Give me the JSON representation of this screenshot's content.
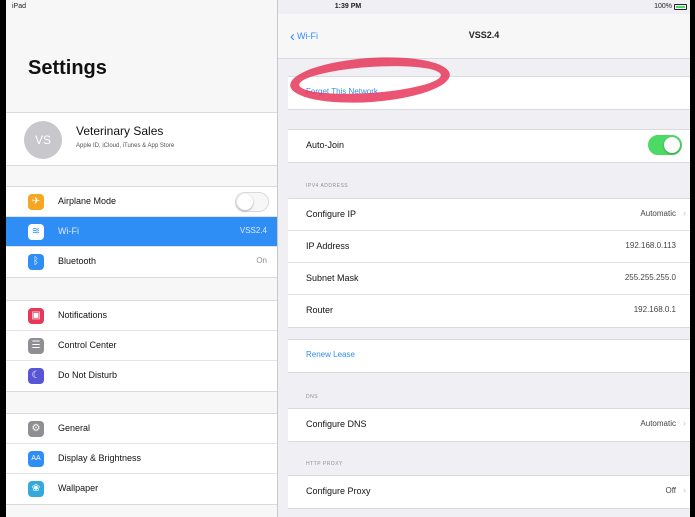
{
  "status": {
    "left": "iPad",
    "time": "1:39 PM",
    "right": "100%"
  },
  "sidebar": {
    "title": "Settings",
    "profile": {
      "initials": "VS",
      "name": "Veterinary Sales",
      "subtitle": "Apple ID, iCloud, iTunes & App Store"
    },
    "group1": [
      {
        "label": "Airplane Mode",
        "icon": "airplane-icon",
        "color": "#f5a623",
        "glyph": "✈",
        "toggle": false
      },
      {
        "label": "Wi-Fi",
        "icon": "wifi-icon",
        "color": "#2f8ef6",
        "glyph": "≋",
        "value": "VSS2.4",
        "selected": true
      },
      {
        "label": "Bluetooth",
        "icon": "bluetooth-icon",
        "color": "#2f8ef6",
        "glyph": "ᛒ",
        "value": "On"
      }
    ],
    "group2": [
      {
        "label": "Notifications",
        "icon": "notifications-icon",
        "color": "#e7375a",
        "glyph": "▣"
      },
      {
        "label": "Control Center",
        "icon": "control-center-icon",
        "color": "#8e8e93",
        "glyph": "☰"
      },
      {
        "label": "Do Not Disturb",
        "icon": "moon-icon",
        "color": "#5856d6",
        "glyph": "☾"
      }
    ],
    "group3": [
      {
        "label": "General",
        "icon": "gear-icon",
        "color": "#8e8e93",
        "glyph": "⚙"
      },
      {
        "label": "Display & Brightness",
        "icon": "brightness-icon",
        "color": "#2f8ef6",
        "glyph": "AA"
      },
      {
        "label": "Wallpaper",
        "icon": "wallpaper-icon",
        "color": "#34aadc",
        "glyph": "❀"
      }
    ]
  },
  "detail": {
    "back_label": "Wi-Fi",
    "title": "VSS2.4",
    "forget_label": "Forget This Network",
    "auto_join": {
      "label": "Auto-Join",
      "on": true
    },
    "ipv4_header": "IPV4 ADDRESS",
    "ipv4": [
      {
        "label": "Configure IP",
        "value": "Automatic",
        "chevron": true
      },
      {
        "label": "IP Address",
        "value": "192.168.0.113"
      },
      {
        "label": "Subnet Mask",
        "value": "255.255.255.0"
      },
      {
        "label": "Router",
        "value": "192.168.0.1"
      }
    ],
    "renew_label": "Renew Lease",
    "dns_header": "DNS",
    "dns": {
      "label": "Configure DNS",
      "value": "Automatic"
    },
    "proxy_header": "HTTP PROXY",
    "proxy": {
      "label": "Configure Proxy",
      "value": "Off"
    }
  },
  "colors": {
    "accent": "#2f8ef6",
    "toggle_on": "#4cd964",
    "highlight_circle": "#e7375a"
  }
}
